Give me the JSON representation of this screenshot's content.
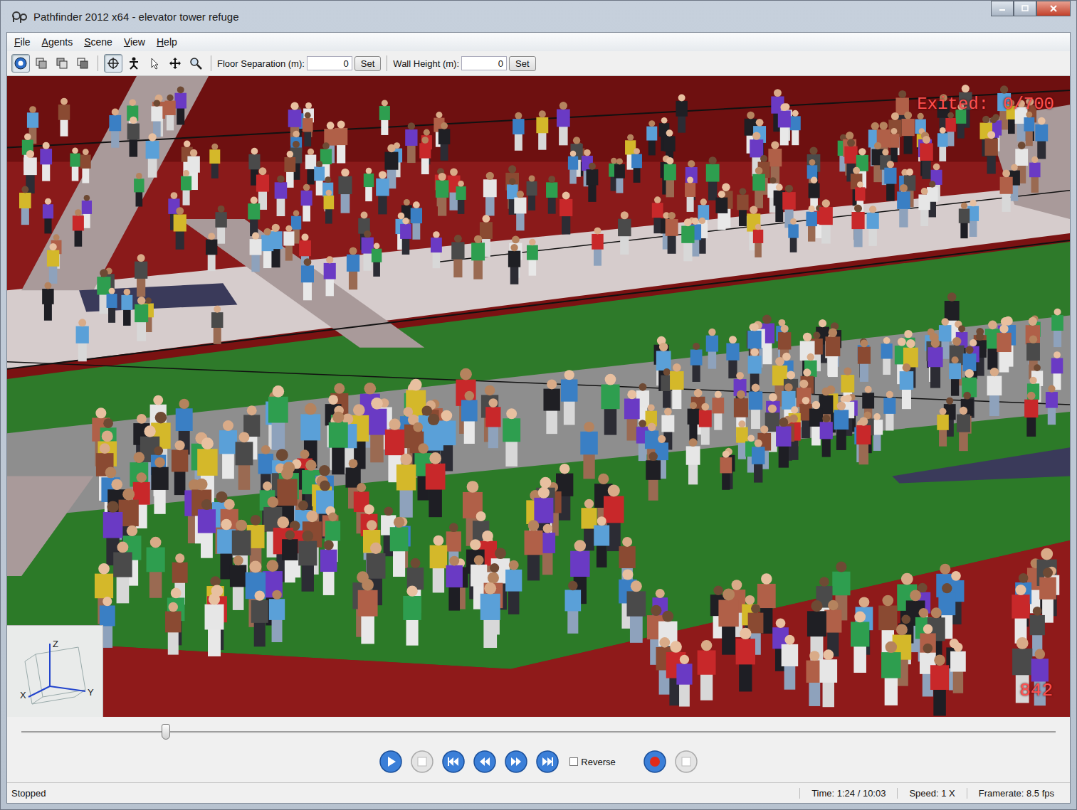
{
  "window": {
    "title": "Pathfinder 2012 x64 - elevator tower refuge"
  },
  "menu": [
    "File",
    "Agents",
    "Scene",
    "View",
    "Help"
  ],
  "toolbar": {
    "tools": [
      {
        "kind": "select",
        "selected": true
      },
      {
        "kind": "view-a",
        "selected": false
      },
      {
        "kind": "view-b",
        "selected": false
      },
      {
        "kind": "view-c",
        "selected": false
      },
      {
        "kind": "orbit",
        "selected": true
      },
      {
        "kind": "agent",
        "selected": false
      },
      {
        "kind": "pointer",
        "selected": false
      },
      {
        "kind": "pan",
        "selected": false
      },
      {
        "kind": "zoom",
        "selected": false
      }
    ],
    "floor_separation": {
      "label": "Floor Separation (m):",
      "value": "0",
      "button": "Set"
    },
    "wall_height": {
      "label": "Wall Height (m):",
      "value": "0",
      "button": "Set"
    }
  },
  "viewport": {
    "exited_label": "Exited:",
    "exited_value": "0/700",
    "counter": "842",
    "axes": [
      "Z",
      "X",
      "Y"
    ]
  },
  "timeline": {
    "level": 0.14
  },
  "playback": {
    "buttons": [
      {
        "kind": "play",
        "disabled": false
      },
      {
        "kind": "stop",
        "disabled": true
      },
      {
        "kind": "to-start",
        "disabled": false
      },
      {
        "kind": "step-back",
        "disabled": false
      },
      {
        "kind": "step-forward",
        "disabled": false
      },
      {
        "kind": "to-end",
        "disabled": false
      }
    ],
    "reverse": {
      "label": "Reverse",
      "checked": false
    },
    "record": [
      {
        "kind": "record",
        "disabled": false
      },
      {
        "kind": "stop-record",
        "disabled": true
      }
    ]
  },
  "status_bar": {
    "state": "Stopped",
    "time": "Time: 1:24 / 10:03",
    "speed": "Speed: 1 X",
    "framerate": "Framerate: 8.5 fps"
  }
}
